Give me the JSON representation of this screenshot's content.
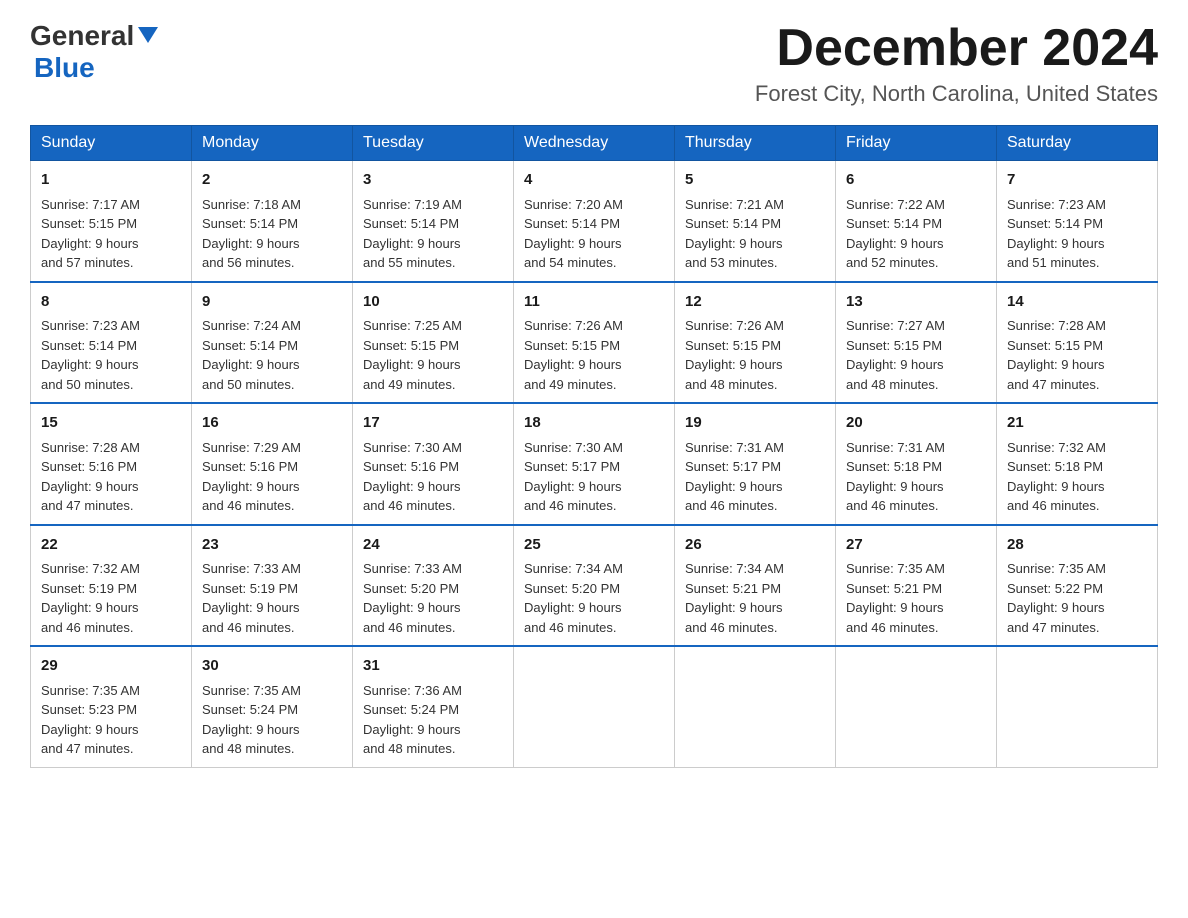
{
  "header": {
    "logo_general": "General",
    "logo_blue": "Blue",
    "month_title": "December 2024",
    "location": "Forest City, North Carolina, United States"
  },
  "days_of_week": [
    "Sunday",
    "Monday",
    "Tuesday",
    "Wednesday",
    "Thursday",
    "Friday",
    "Saturday"
  ],
  "weeks": [
    [
      {
        "day": "1",
        "sunrise": "7:17 AM",
        "sunset": "5:15 PM",
        "daylight": "9 hours and 57 minutes."
      },
      {
        "day": "2",
        "sunrise": "7:18 AM",
        "sunset": "5:14 PM",
        "daylight": "9 hours and 56 minutes."
      },
      {
        "day": "3",
        "sunrise": "7:19 AM",
        "sunset": "5:14 PM",
        "daylight": "9 hours and 55 minutes."
      },
      {
        "day": "4",
        "sunrise": "7:20 AM",
        "sunset": "5:14 PM",
        "daylight": "9 hours and 54 minutes."
      },
      {
        "day": "5",
        "sunrise": "7:21 AM",
        "sunset": "5:14 PM",
        "daylight": "9 hours and 53 minutes."
      },
      {
        "day": "6",
        "sunrise": "7:22 AM",
        "sunset": "5:14 PM",
        "daylight": "9 hours and 52 minutes."
      },
      {
        "day": "7",
        "sunrise": "7:23 AM",
        "sunset": "5:14 PM",
        "daylight": "9 hours and 51 minutes."
      }
    ],
    [
      {
        "day": "8",
        "sunrise": "7:23 AM",
        "sunset": "5:14 PM",
        "daylight": "9 hours and 50 minutes."
      },
      {
        "day": "9",
        "sunrise": "7:24 AM",
        "sunset": "5:14 PM",
        "daylight": "9 hours and 50 minutes."
      },
      {
        "day": "10",
        "sunrise": "7:25 AM",
        "sunset": "5:15 PM",
        "daylight": "9 hours and 49 minutes."
      },
      {
        "day": "11",
        "sunrise": "7:26 AM",
        "sunset": "5:15 PM",
        "daylight": "9 hours and 49 minutes."
      },
      {
        "day": "12",
        "sunrise": "7:26 AM",
        "sunset": "5:15 PM",
        "daylight": "9 hours and 48 minutes."
      },
      {
        "day": "13",
        "sunrise": "7:27 AM",
        "sunset": "5:15 PM",
        "daylight": "9 hours and 48 minutes."
      },
      {
        "day": "14",
        "sunrise": "7:28 AM",
        "sunset": "5:15 PM",
        "daylight": "9 hours and 47 minutes."
      }
    ],
    [
      {
        "day": "15",
        "sunrise": "7:28 AM",
        "sunset": "5:16 PM",
        "daylight": "9 hours and 47 minutes."
      },
      {
        "day": "16",
        "sunrise": "7:29 AM",
        "sunset": "5:16 PM",
        "daylight": "9 hours and 46 minutes."
      },
      {
        "day": "17",
        "sunrise": "7:30 AM",
        "sunset": "5:16 PM",
        "daylight": "9 hours and 46 minutes."
      },
      {
        "day": "18",
        "sunrise": "7:30 AM",
        "sunset": "5:17 PM",
        "daylight": "9 hours and 46 minutes."
      },
      {
        "day": "19",
        "sunrise": "7:31 AM",
        "sunset": "5:17 PM",
        "daylight": "9 hours and 46 minutes."
      },
      {
        "day": "20",
        "sunrise": "7:31 AM",
        "sunset": "5:18 PM",
        "daylight": "9 hours and 46 minutes."
      },
      {
        "day": "21",
        "sunrise": "7:32 AM",
        "sunset": "5:18 PM",
        "daylight": "9 hours and 46 minutes."
      }
    ],
    [
      {
        "day": "22",
        "sunrise": "7:32 AM",
        "sunset": "5:19 PM",
        "daylight": "9 hours and 46 minutes."
      },
      {
        "day": "23",
        "sunrise": "7:33 AM",
        "sunset": "5:19 PM",
        "daylight": "9 hours and 46 minutes."
      },
      {
        "day": "24",
        "sunrise": "7:33 AM",
        "sunset": "5:20 PM",
        "daylight": "9 hours and 46 minutes."
      },
      {
        "day": "25",
        "sunrise": "7:34 AM",
        "sunset": "5:20 PM",
        "daylight": "9 hours and 46 minutes."
      },
      {
        "day": "26",
        "sunrise": "7:34 AM",
        "sunset": "5:21 PM",
        "daylight": "9 hours and 46 minutes."
      },
      {
        "day": "27",
        "sunrise": "7:35 AM",
        "sunset": "5:21 PM",
        "daylight": "9 hours and 46 minutes."
      },
      {
        "day": "28",
        "sunrise": "7:35 AM",
        "sunset": "5:22 PM",
        "daylight": "9 hours and 47 minutes."
      }
    ],
    [
      {
        "day": "29",
        "sunrise": "7:35 AM",
        "sunset": "5:23 PM",
        "daylight": "9 hours and 47 minutes."
      },
      {
        "day": "30",
        "sunrise": "7:35 AM",
        "sunset": "5:24 PM",
        "daylight": "9 hours and 48 minutes."
      },
      {
        "day": "31",
        "sunrise": "7:36 AM",
        "sunset": "5:24 PM",
        "daylight": "9 hours and 48 minutes."
      },
      null,
      null,
      null,
      null
    ]
  ],
  "labels": {
    "sunrise": "Sunrise:",
    "sunset": "Sunset:",
    "daylight": "Daylight:"
  }
}
